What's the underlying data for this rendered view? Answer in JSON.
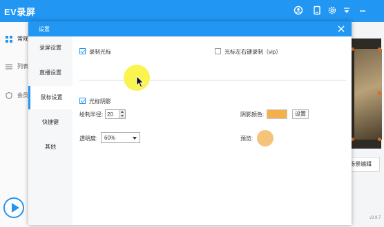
{
  "app": {
    "title": "EV录屏",
    "version": "v3.9.7",
    "sidebar": {
      "items": [
        {
          "label": "常规"
        },
        {
          "label": "列表"
        },
        {
          "label": "会员"
        }
      ]
    },
    "scene_button_label": "场景编辑",
    "titlebar_icons": [
      "user-icon",
      "book-icon",
      "gear-icon",
      "dropdown-icon",
      "minimize-icon"
    ],
    "accent_color": "#2196f3"
  },
  "dialog": {
    "title": "设置",
    "nav": [
      {
        "label": "录屏设置"
      },
      {
        "label": "直播设置"
      },
      {
        "label": "鼠标设置"
      },
      {
        "label": "快捷键"
      },
      {
        "label": "其他"
      }
    ],
    "active_nav": "鼠标设置",
    "record_cursor": {
      "label": "录制光标",
      "checked": true
    },
    "cursor_click_record": {
      "label": "光标左右键录制（vip）",
      "checked": false
    },
    "cursor_shadow": {
      "label": "光标阴影",
      "checked": true
    },
    "radius": {
      "label": "绘制半径:",
      "value": "20"
    },
    "shadow_color": {
      "label": "阴影颜色:",
      "value": "#f2b14a",
      "button_label": "设置"
    },
    "opacity": {
      "label": "透明度:",
      "value": "60%"
    },
    "preview": {
      "label": "预览:",
      "color": "#f5c47a"
    },
    "cursor_highlight_color": "#faf450"
  }
}
